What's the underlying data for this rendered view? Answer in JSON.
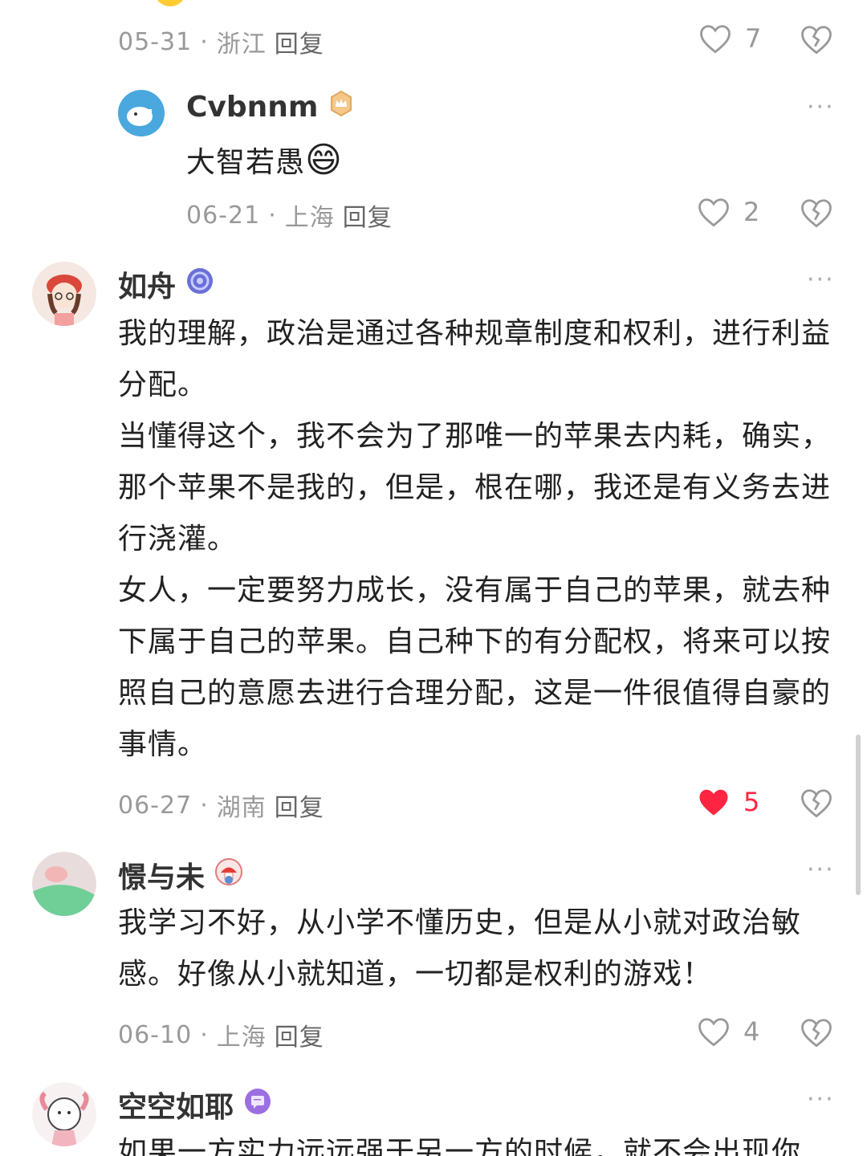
{
  "comments": [
    {
      "date": "05-31",
      "location": "浙江",
      "reply_label": "回复",
      "likes": "7"
    },
    {
      "username": "Cvbnnm",
      "text": "大智若愚",
      "emoji": "😄",
      "date": "06-21",
      "location": "上海",
      "reply_label": "回复",
      "likes": "2"
    },
    {
      "username": "如舟",
      "paragraphs": [
        "我的理解，政治是通过各种规章制度和权利，进行利益分配。",
        "当懂得这个，我不会为了那唯一的苹果去内耗，确实，那个苹果不是我的，但是，根在哪，我还是有义务去进行浇灌。",
        "女人，一定要努力成长，没有属于自己的苹果，就去种下属于自己的苹果。自己种下的有分配权，将来可以按照自己的意愿去进行合理分配，这是一件很值得自豪的事情。"
      ],
      "date": "06-27",
      "location": "湖南",
      "reply_label": "回复",
      "likes": "5",
      "liked": true
    },
    {
      "username": "憬与未",
      "text": "我学习不好，从小学不懂历史，但是从小就对政治敏感。好像从小就知道，一切都是权利的游戏！",
      "date": "06-10",
      "location": "上海",
      "reply_label": "回复",
      "likes": "4"
    },
    {
      "username": "空空如耶",
      "text": "如果一方实力远远强于另一方的时候，就不会出现你"
    }
  ],
  "separator": "·",
  "more_label": "···",
  "colors": {
    "liked_heart": "#ff2442",
    "meta_text": "#999999",
    "username": "#333333"
  },
  "icons": {
    "like": "heart-outline-icon",
    "liked": "heart-filled-icon",
    "dislike": "broken-heart-icon",
    "more": "ellipsis-icon"
  }
}
